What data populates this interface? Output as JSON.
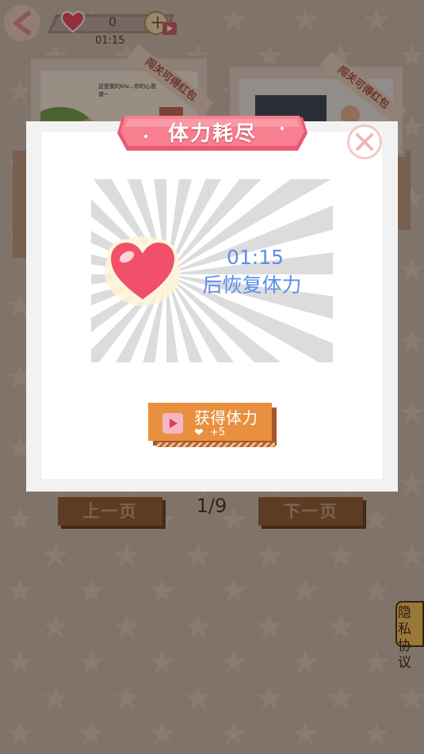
{
  "hud": {
    "lives": "0",
    "timer": "01:15"
  },
  "cards": [
    {
      "ribbon": "闯关可得红包",
      "caption": "这是我的ktv...你的心愿谱~"
    },
    {
      "ribbon": "闯关可得红包"
    }
  ],
  "pagination": {
    "prev_label": "上一页",
    "next_label": "下一页",
    "page": "1/9"
  },
  "privacy_label": "隐私协议",
  "modal": {
    "title": "体力耗尽",
    "timer": "01:15",
    "recover_text": "后恢复体力",
    "get_button": {
      "label": "获得体力",
      "reward": "+5"
    }
  },
  "colors": {
    "accent_orange": "#e8903f",
    "timer_blue": "#5a8fe8",
    "banner_pink": "#f06a7e",
    "brown_button": "#8a5a33"
  }
}
